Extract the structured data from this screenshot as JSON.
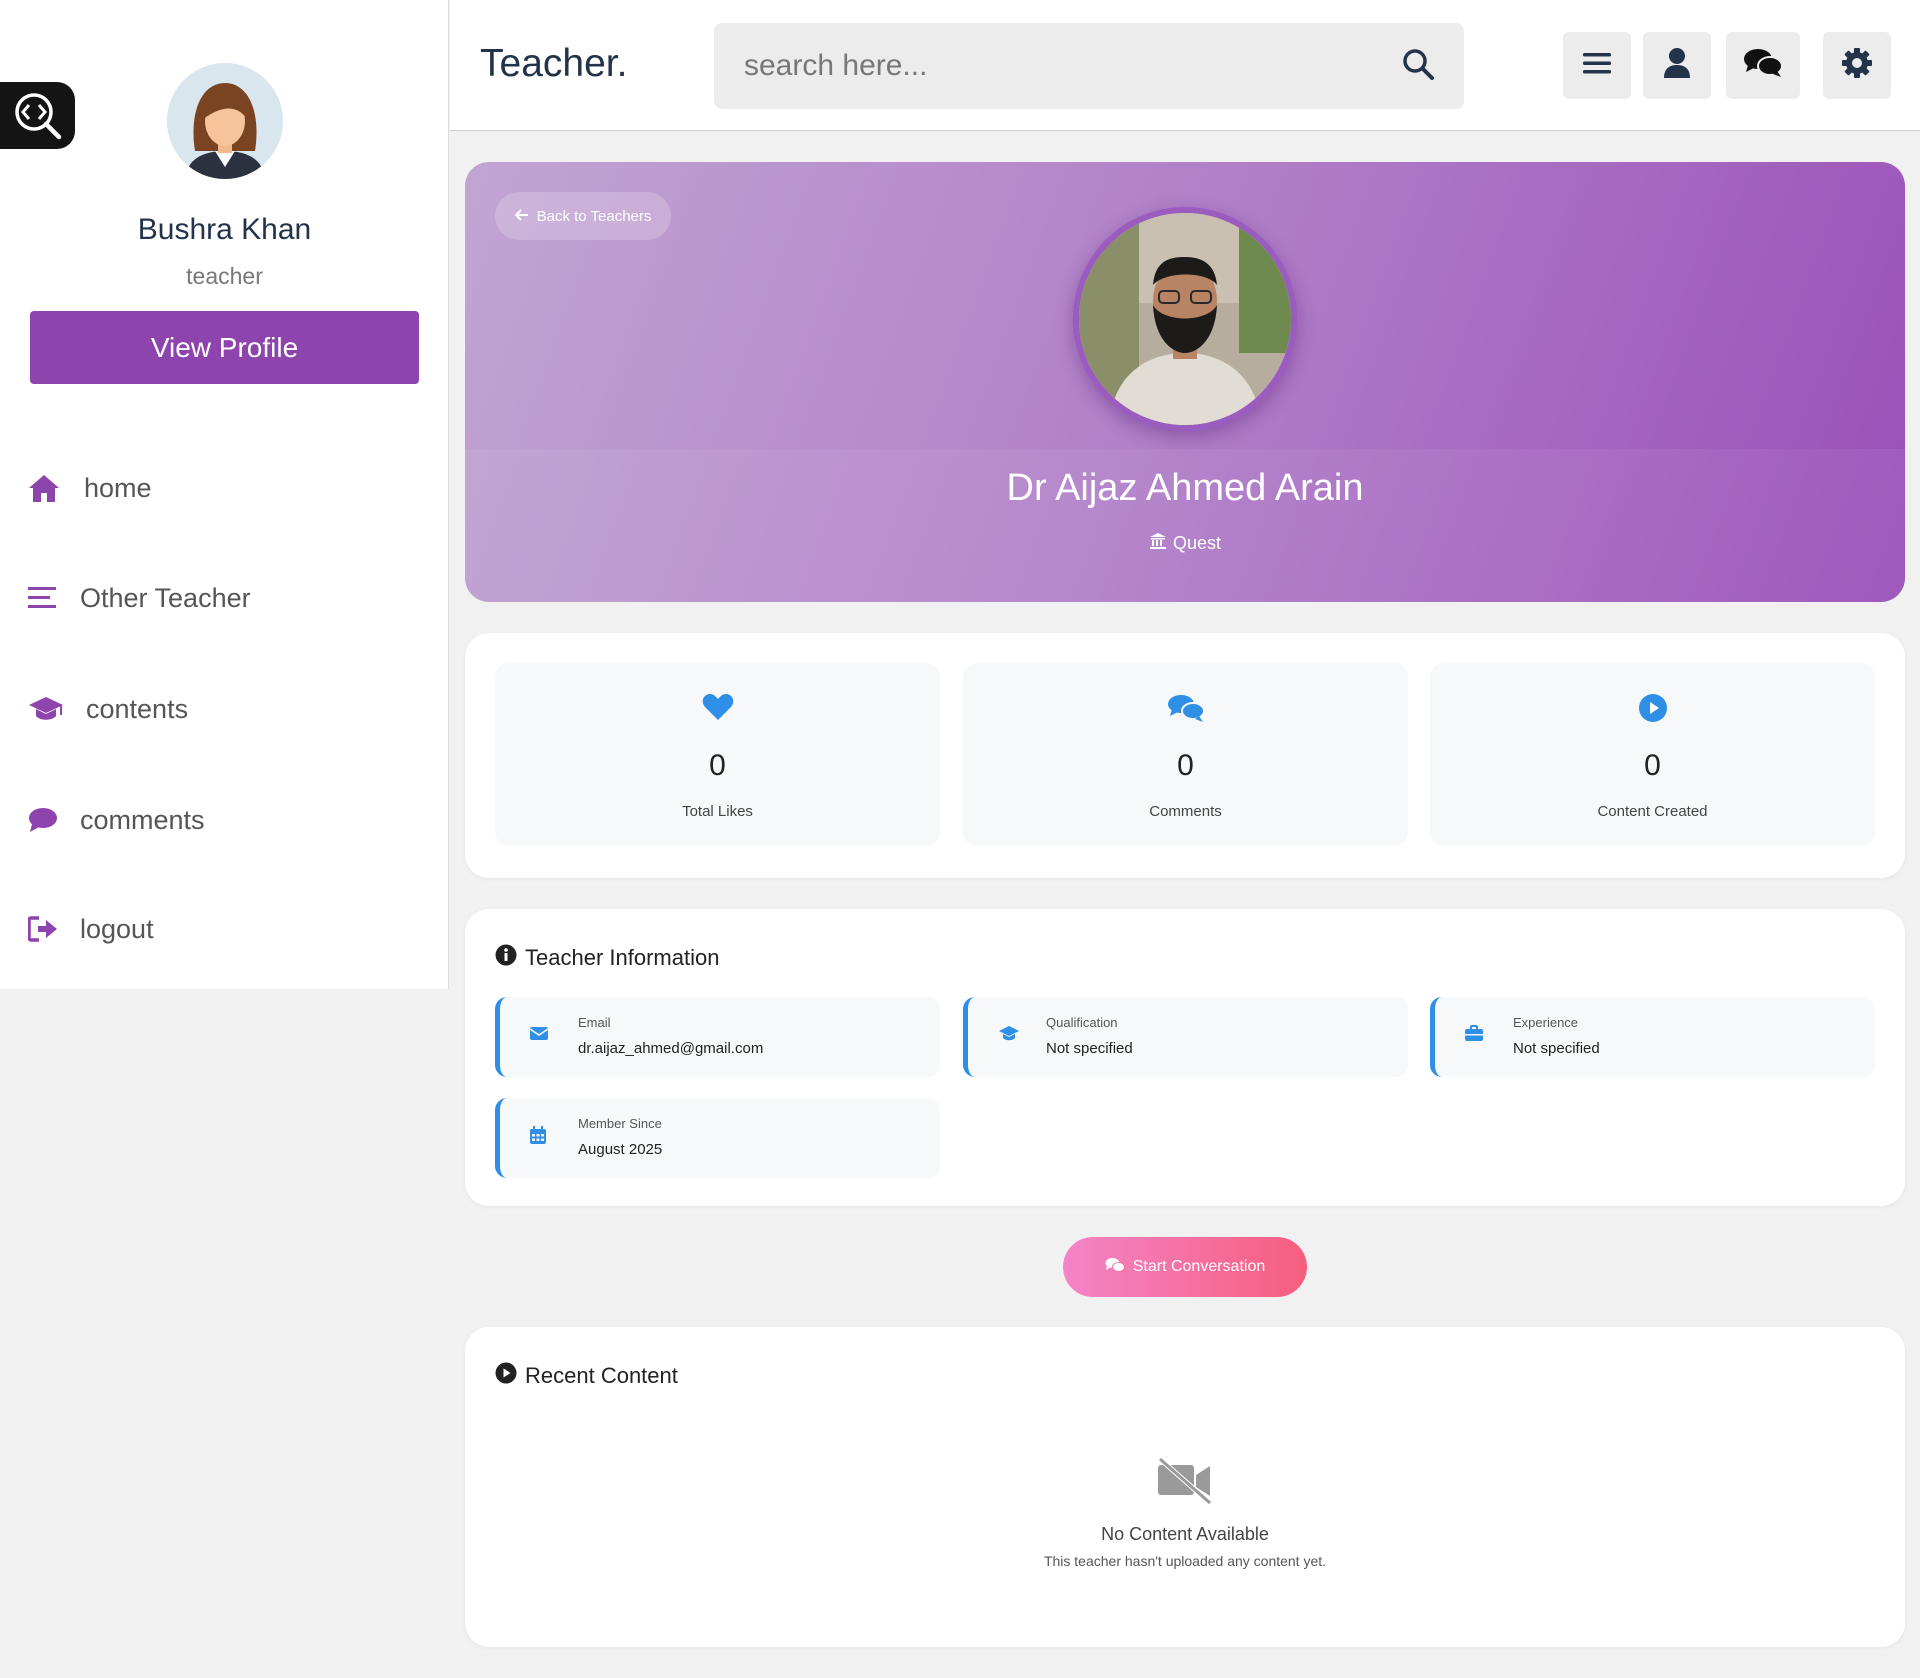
{
  "sidebar": {
    "user": {
      "name": "Bushra Khan",
      "role": "teacher"
    },
    "view_profile_label": "View Profile",
    "nav": [
      {
        "label": "home",
        "icon": "home-icon"
      },
      {
        "label": "Other Teacher",
        "icon": "menu-lines-icon"
      },
      {
        "label": "contents",
        "icon": "graduation-cap-icon"
      },
      {
        "label": "comments",
        "icon": "comment-icon"
      },
      {
        "label": "logout",
        "icon": "logout-icon"
      }
    ]
  },
  "header": {
    "brand": "Teacher.",
    "search_placeholder": "search here...",
    "buttons": [
      "menu-icon",
      "user-icon",
      "chat-icon",
      "gear-icon"
    ]
  },
  "hero": {
    "back_label": "Back to Teachers",
    "teacher_name": "Dr Aijaz Ahmed Arain",
    "institution": "Quest"
  },
  "stats": [
    {
      "value": "0",
      "label": "Total Likes",
      "icon": "heart-icon"
    },
    {
      "value": "0",
      "label": "Comments",
      "icon": "comments-icon"
    },
    {
      "value": "0",
      "label": "Content Created",
      "icon": "play-circle-icon"
    }
  ],
  "info": {
    "title": "Teacher Information",
    "items": [
      {
        "label": "Email",
        "value": "dr.aijaz_ahmed@gmail.com",
        "icon": "envelope-icon"
      },
      {
        "label": "Qualification",
        "value": "Not specified",
        "icon": "graduation-cap-icon"
      },
      {
        "label": "Experience",
        "value": "Not specified",
        "icon": "briefcase-icon"
      },
      {
        "label": "Member Since",
        "value": "August 2025",
        "icon": "calendar-icon"
      }
    ]
  },
  "start_conversation_label": "Start Conversation",
  "recent": {
    "title": "Recent Content",
    "empty_title": "No Content Available",
    "empty_sub": "This teacher hasn't uploaded any content yet."
  },
  "colors": {
    "accent": "#8e44ad",
    "info_blue": "#2f8fe6",
    "text_dark": "#23344a"
  }
}
